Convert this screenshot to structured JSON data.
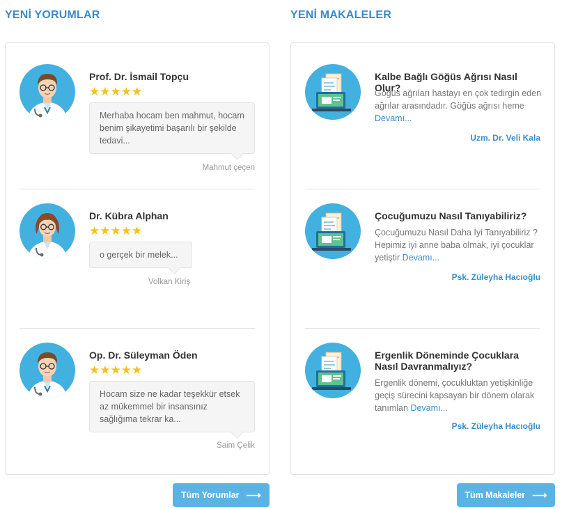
{
  "sections": {
    "comments_title": "YENİ YORUMLAR",
    "articles_title": "YENİ MAKALELER"
  },
  "comments": [
    {
      "doctor": "Prof. Dr. İsmail Topçu",
      "rating": "★★★★★",
      "text": "Merhaba hocam ben mahmut, hocam benim şikayetimi başarılı bir şekilde tedavi...",
      "commenter": "Mahmut çeçen",
      "avatar": "male-doctor-avatar"
    },
    {
      "doctor": "Dr. Kübra Alphan",
      "rating": "★★★★★",
      "text": "o gerçek bir melek...",
      "commenter": "Volkan Kiriş",
      "avatar": "female-doctor-avatar"
    },
    {
      "doctor": "Op. Dr. Süleyman Öden",
      "rating": "★★★★★",
      "text": "Hocam size ne kadar teşekkür etsek az mükemmel bir insansınız sağlığıma tekrar ka...",
      "commenter": "Saim Çelik",
      "avatar": "male-doctor-avatar"
    }
  ],
  "articles": [
    {
      "title": "Kalbe Bağlı Göğüs Ağrısı Nasıl Olur?",
      "excerpt": "Göğüs ağrıları hastayı en çok tedirgin eden ağrılar arasındadır. Göğüs ağrısı heme",
      "more": "Devamı...",
      "author": "Uzm. Dr. Veli Kala",
      "icon": "laptop-document-icon"
    },
    {
      "title": "Çocuğumuzu Nasıl Tanıyabiliriz?",
      "excerpt": "Çocuğumuzu Nasıl Daha İyi Tanıyabiliriz ? Hepimiz iyi anne baba olmak, iyi çocuklar yetiştir",
      "more": "Devamı...",
      "author": "Psk. Züleyha Hacıoğlu",
      "icon": "laptop-document-icon"
    },
    {
      "title": "Ergenlik Döneminde Çocuklara Nasıl Davranmalıyız?",
      "excerpt": "Ergenlik dönemi, çocukluktan yetişkinliğe geçiş sürecini kapsayan bir dönem olarak tanımlan",
      "more": "Devamı...",
      "author": "Psk. Züleyha Hacıoğlu",
      "icon": "laptop-document-icon"
    }
  ],
  "buttons": {
    "all_comments": "Tüm Yorumlar",
    "all_articles": "Tüm Makaleler",
    "arrow_icon": "arrow-right-icon"
  },
  "colors": {
    "accent": "#3a8cc8",
    "button": "#5bb3e4",
    "star": "#f5c21b",
    "avatar_bg": "#43b1e0"
  }
}
